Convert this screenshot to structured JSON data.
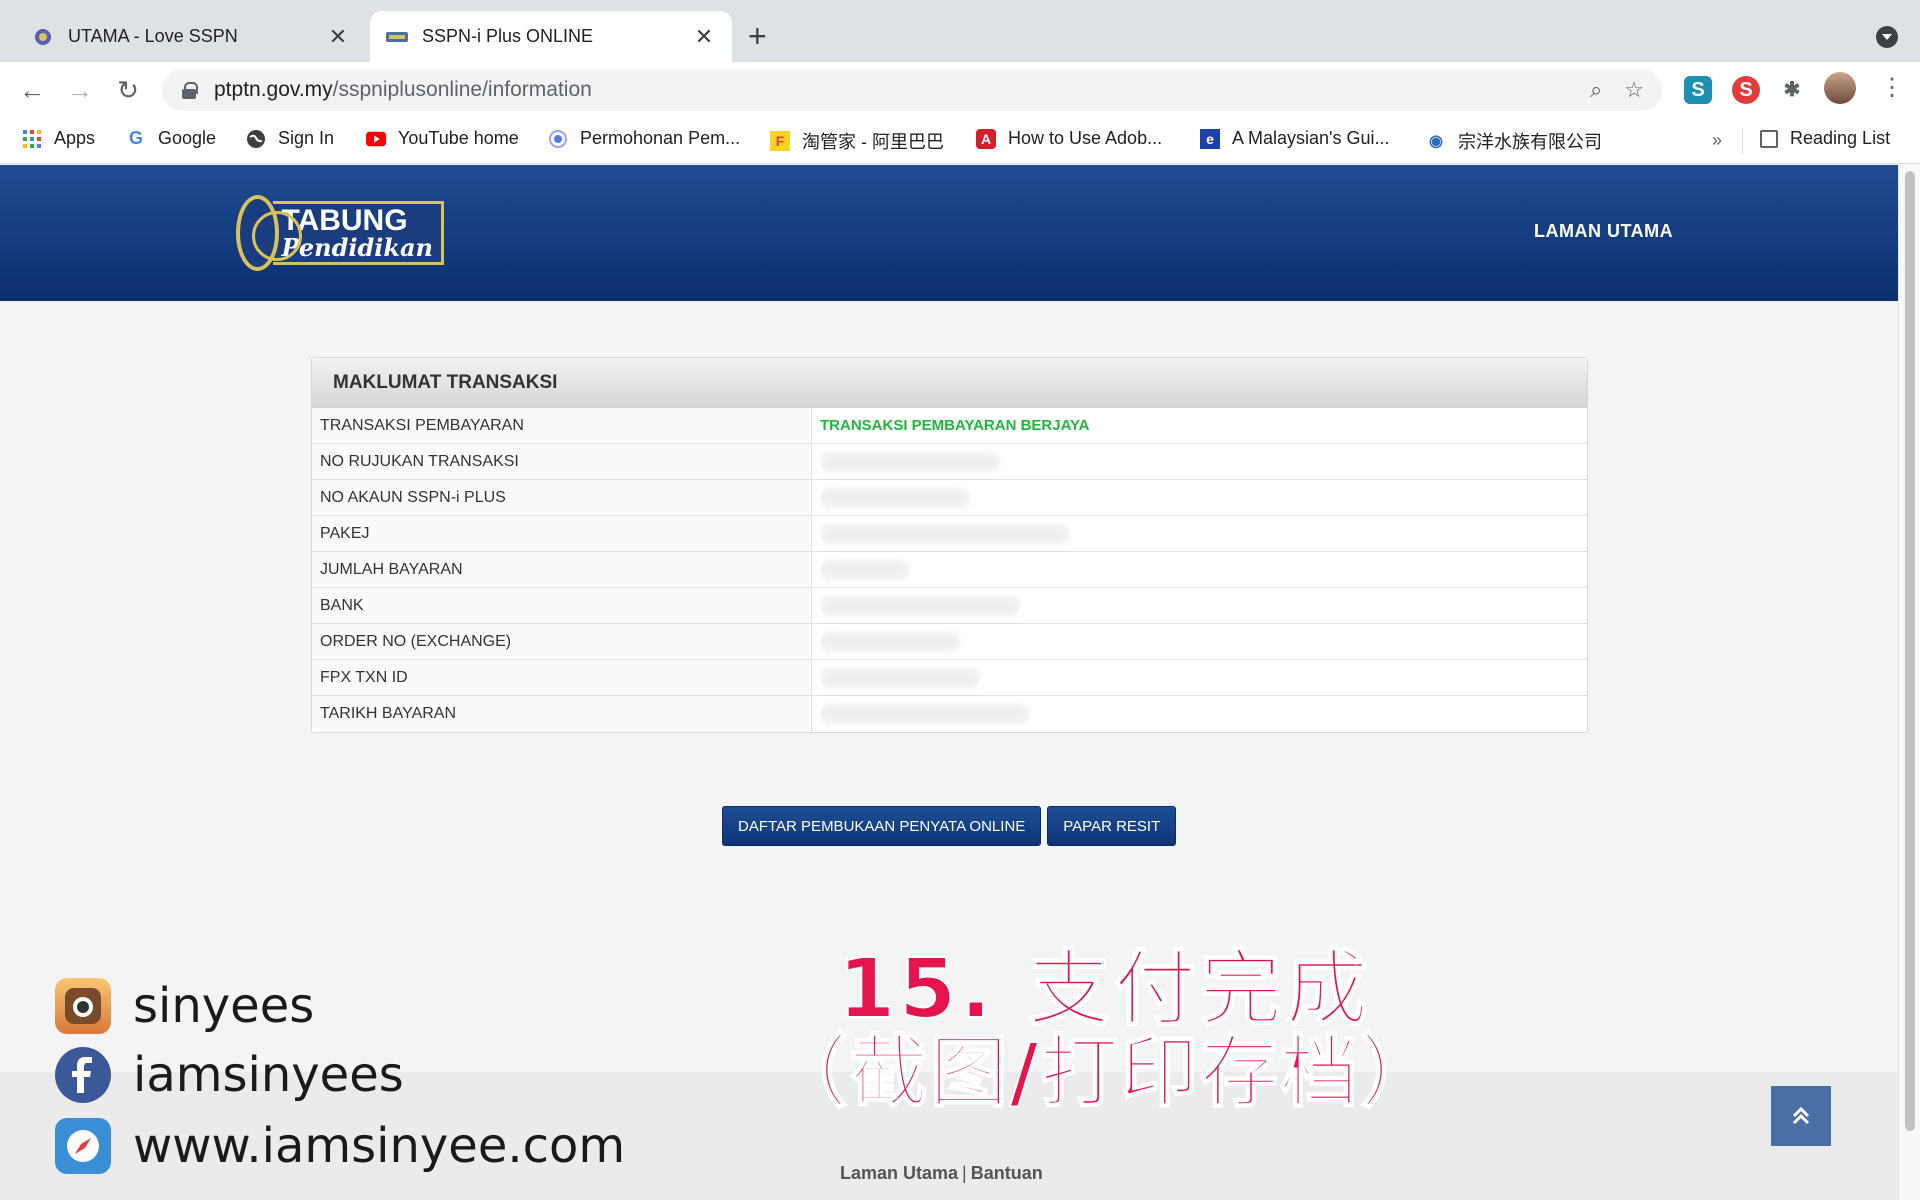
{
  "browser": {
    "tabs": [
      {
        "title": "UTAMA - Love SSPN"
      },
      {
        "title": "SSPN-i Plus ONLINE"
      }
    ],
    "url_host": "ptptn.gov.my",
    "url_path": "/sspniplusonline/information",
    "bookmarks": [
      {
        "label": "Apps",
        "icon": "apps-grid-icon"
      },
      {
        "label": "Google",
        "icon": "google-icon"
      },
      {
        "label": "Sign In",
        "icon": "globe-icon"
      },
      {
        "label": "YouTube home",
        "icon": "youtube-icon"
      },
      {
        "label": "Permohonan Pem...",
        "icon": "circle-icon"
      },
      {
        "label": "淘管家 - 阿里巴巴",
        "icon": "taobao-icon"
      },
      {
        "label": "How to Use Adob...",
        "icon": "adobe-icon"
      },
      {
        "label": "A Malaysian's Gui...",
        "icon": "e-icon"
      },
      {
        "label": "宗洋水族有限公司",
        "icon": "eye-icon"
      }
    ],
    "bookmarks_more": "»",
    "reading_list": "Reading List",
    "extensions": [
      "S",
      "S"
    ]
  },
  "site": {
    "logo_word1": "TABUNG",
    "logo_word2": "Pendidikan",
    "nav_home": "LAMAN UTAMA"
  },
  "panel": {
    "title": "MAKLUMAT TRANSAKSI",
    "rows": [
      {
        "label": "TRANSAKSI PEMBAYARAN",
        "value": "TRANSAKSI PEMBAYARAN BERJAYA"
      },
      {
        "label": "NO RUJUKAN TRANSAKSI"
      },
      {
        "label": "NO AKAUN SSPN-i PLUS"
      },
      {
        "label": "PAKEJ"
      },
      {
        "label": "JUMLAH BAYARAN"
      },
      {
        "label": "BANK"
      },
      {
        "label": "ORDER NO (EXCHANGE)"
      },
      {
        "label": "FPX TXN ID"
      },
      {
        "label": "TARIKH BAYARAN"
      }
    ]
  },
  "buttons": {
    "register": "DAFTAR PEMBUKAAN PENYATA ONLINE",
    "receipt": "PAPAR RESIT"
  },
  "footer": {
    "home": "Laman Utama",
    "separator": "|",
    "help": "Bantuan"
  },
  "overlay": {
    "instagram": "sinyees",
    "facebook": "iamsinyees",
    "website": "www.iamsinyee.com",
    "caption_line1": "15. 支付完成",
    "caption_line2": "（截图/打印存档）",
    "caption_color": "#e3144e"
  },
  "colors": {
    "header_blue": "#1f4c91",
    "success_green": "#22b53c",
    "button_blue": "#0f3577"
  }
}
